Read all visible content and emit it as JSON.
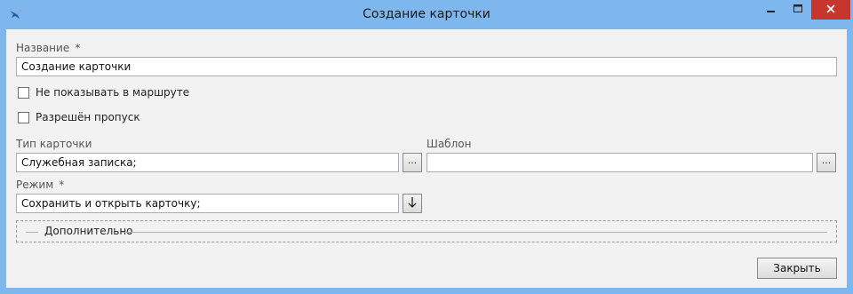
{
  "window": {
    "title": "Создание карточки",
    "titlebar_color": "#7eb6ee",
    "close_color": "#c7362e",
    "icons": [
      "app-icon",
      "minimize-icon",
      "maximize-icon",
      "close-icon"
    ]
  },
  "form": {
    "name_label": "Название",
    "required_mark": "*",
    "name_value": "Создание карточки",
    "hide_in_route_label": "Не показывать в маршруте",
    "hide_in_route_checked": false,
    "skip_allowed_label": "Разрешён пропуск",
    "skip_allowed_checked": false,
    "card_type_label": "Тип карточки",
    "card_type_value": "Служебная записка;",
    "template_label": "Шаблон",
    "template_value": "",
    "browse_label": "...",
    "mode_label": "Режим",
    "mode_value": "Сохранить и открыть карточку;"
  },
  "extra": {
    "group_label": "Дополнительно"
  },
  "footer": {
    "close_label": "Закрыть"
  }
}
